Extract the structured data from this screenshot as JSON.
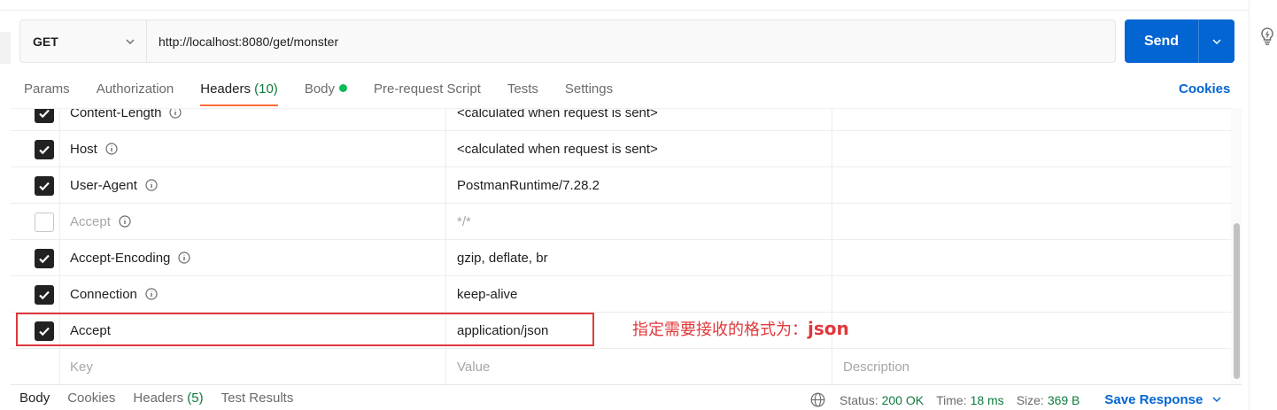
{
  "request": {
    "method": "GET",
    "url": "http://localhost:8080/get/monster",
    "send_label": "Send"
  },
  "tabs": [
    {
      "label": "Params"
    },
    {
      "label": "Authorization"
    },
    {
      "label": "Headers",
      "count": "(10)"
    },
    {
      "label": "Body"
    },
    {
      "label": "Pre-request Script"
    },
    {
      "label": "Tests"
    },
    {
      "label": "Settings"
    }
  ],
  "cookies_label": "Cookies",
  "headers": [
    {
      "key": "Content-Length",
      "value": "<calculated when request is sent>",
      "checked": true
    },
    {
      "key": "Host",
      "value": "<calculated when request is sent>",
      "checked": true
    },
    {
      "key": "User-Agent",
      "value": "PostmanRuntime/7.28.2",
      "checked": true
    },
    {
      "key": "Accept",
      "value": "*/*",
      "checked": false
    },
    {
      "key": "Accept-Encoding",
      "value": "gzip, deflate, br",
      "checked": true
    },
    {
      "key": "Connection",
      "value": "keep-alive",
      "checked": true
    },
    {
      "key": "Accept",
      "value": "application/json",
      "checked": true
    }
  ],
  "placeholder_row": {
    "key": "Key",
    "value": "Value",
    "description": "Description"
  },
  "annotation": {
    "text": "指定需要接收的格式为：",
    "emphasis": "json"
  },
  "response": {
    "tabs": [
      {
        "label": "Body"
      },
      {
        "label": "Cookies"
      },
      {
        "label": "Headers",
        "count": "(5)"
      },
      {
        "label": "Test Results"
      }
    ],
    "status_label": "Status:",
    "status_value": "200 OK",
    "time_label": "Time:",
    "time_value": "18 ms",
    "size_label": "Size:",
    "size_value": "369 B",
    "save_label": "Save Response"
  },
  "colors": {
    "accent": "#ff6c37",
    "primary": "#0265d2",
    "success": "#0f7b3d",
    "annotation": "#e0383b"
  }
}
